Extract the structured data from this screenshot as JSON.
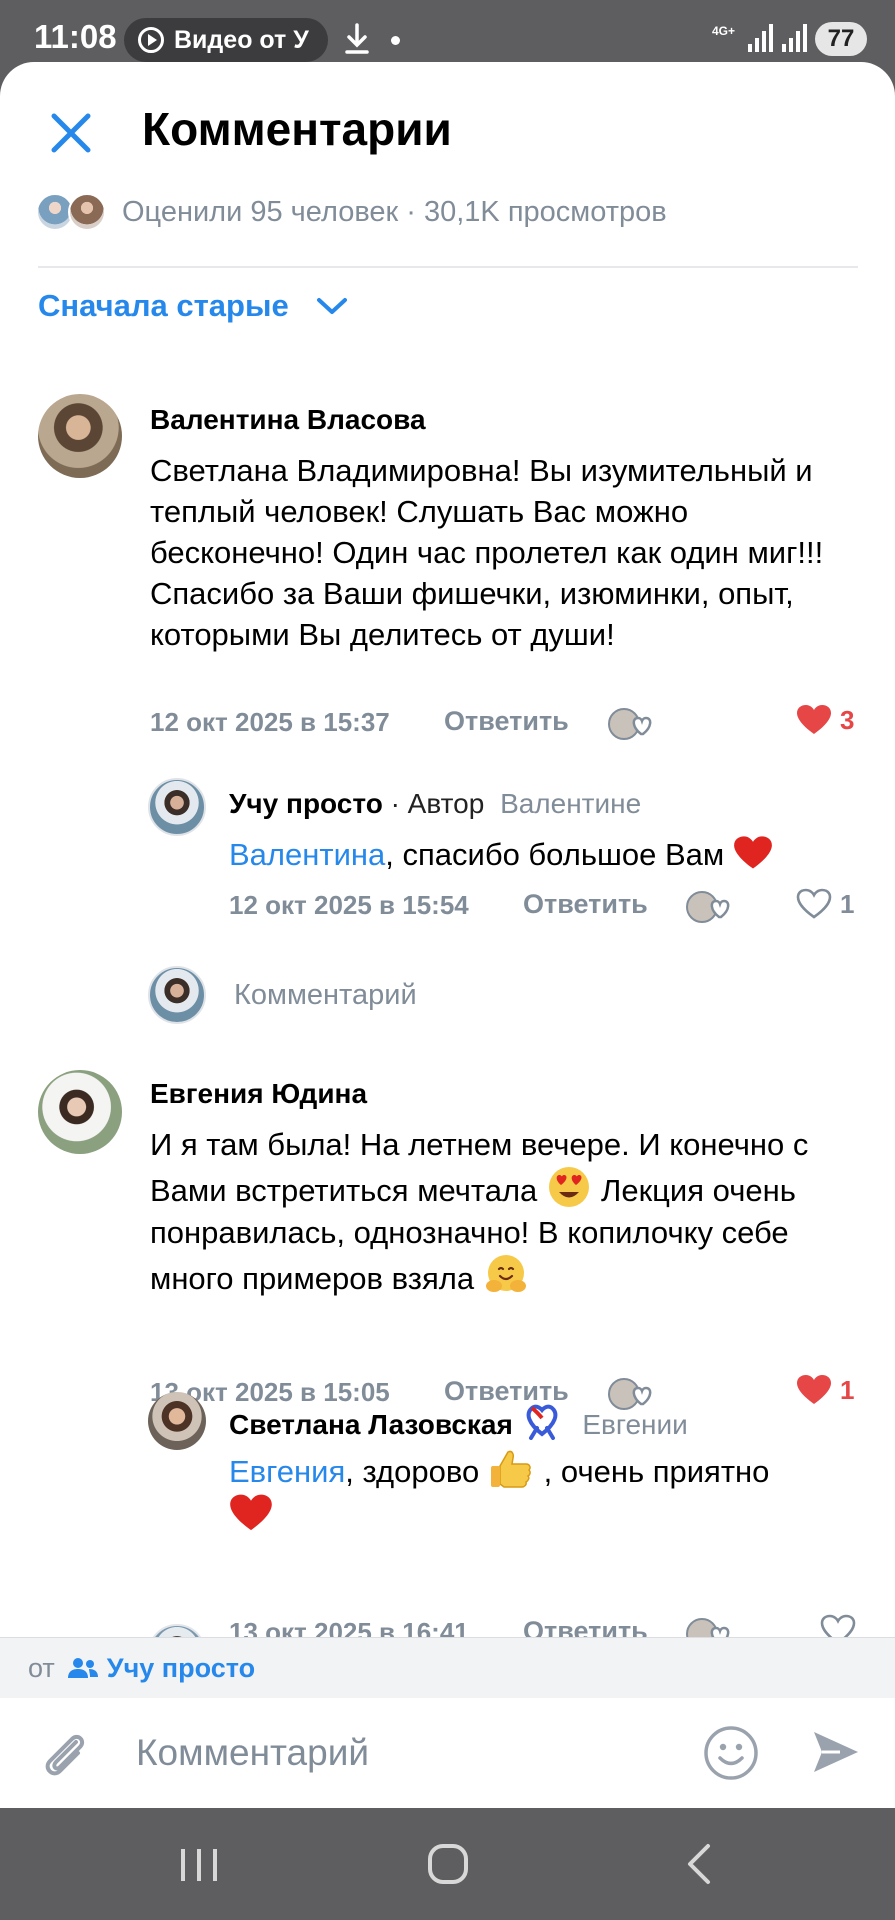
{
  "status_bar": {
    "time": "11:08",
    "pill_text": "Видео от У",
    "network": "4G+",
    "battery": "77"
  },
  "header": {
    "title": "Комментарии",
    "stats": "Оценили 95 человек · 30,1K просмотров",
    "sort_label": "Сначала старые"
  },
  "comments": [
    {
      "name": "Валентина Власова",
      "text": "Светлана Владимировна! Вы изумительный и теплый человек! Слушать Вас можно бесконечно! Один час пролетел как один миг!!!\nСпасибо за Ваши фишечки, изюминки, опыт, которыми Вы делитесь от души!",
      "date": "12 окт 2025 в 15:37",
      "reply_label": "Ответить",
      "likes": "3",
      "liked": true,
      "replies": [
        {
          "name": "Учу просто",
          "author_tag": "· Автор",
          "addressee": "Валентине",
          "mention": "Валентина",
          "text": ", спасибо большое Вам",
          "emoji": "❤️",
          "date": "12 окт 2025 в 15:54",
          "reply_label": "Ответить",
          "likes": "1",
          "liked": false
        }
      ]
    },
    {
      "name": "Евгения Юдина",
      "text_parts": [
        "И я там была! На летнем вечере. И конечно с Вами встретиться мечтала",
        "😍",
        " Лекция очень понравилась, однозначно! В копилочку себе много примеров взяла",
        "🤗"
      ],
      "date": "13 окт 2025 в 15:05",
      "reply_label": "Ответить",
      "likes": "1",
      "liked": true,
      "replies": [
        {
          "name": "Светлана Лазовская",
          "name_emoji": "🎗️",
          "addressee": "Евгении",
          "mention": "Евгения",
          "text_a": ", здорово ",
          "emoji_a": "👍",
          "text_b": ", очень приятно",
          "emoji_b": "❤️",
          "date": "13 окт 2025 в 16:41",
          "reply_label": "Ответить",
          "likes": "",
          "liked": false
        }
      ]
    }
  ],
  "reply_composer": {
    "placeholder": "Комментарий"
  },
  "from_bar": {
    "prefix": "от",
    "name": "Учу просто"
  },
  "composer": {
    "placeholder": "Комментарий"
  },
  "colors": {
    "accent": "#2688eb",
    "secondary_text": "#818c99",
    "like_red": "#e64646"
  }
}
